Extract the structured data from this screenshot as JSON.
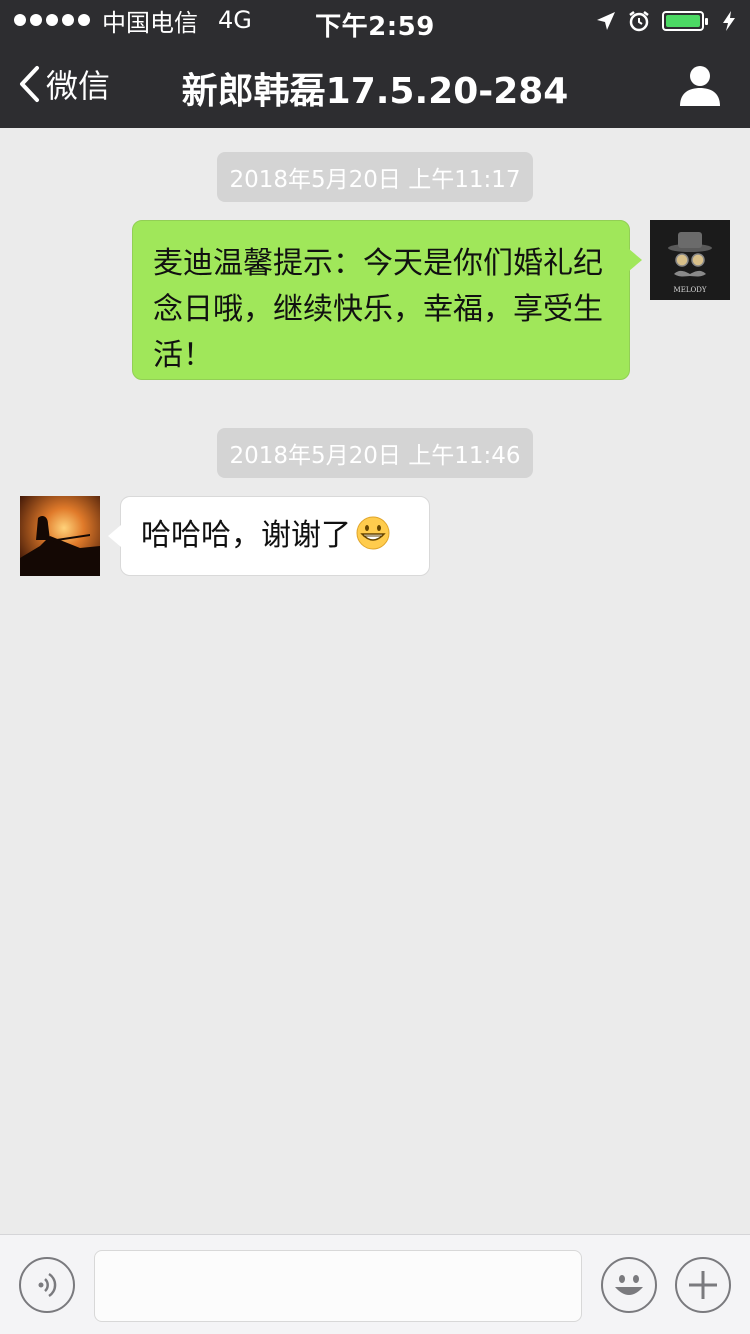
{
  "status_bar": {
    "carrier": "中国电信",
    "network": "4G",
    "time": "下午2:59"
  },
  "nav": {
    "back_label": "微信",
    "title": "新郎韩磊17.5.20-284"
  },
  "messages": [
    {
      "timestamp": "2018年5月20日 上午11:17"
    },
    {
      "text": "麦迪温馨提示：今天是你们婚礼纪念日哦，继续快乐，幸福，享受生活！",
      "sender": "me"
    },
    {
      "timestamp": "2018年5月20日 上午11:46"
    },
    {
      "text": "哈哈哈，谢谢了",
      "sender": "other",
      "emoji": "grinning-face-emoji"
    }
  ],
  "avatars": {
    "me_logo_text": "MELODY"
  },
  "colors": {
    "header_bg": "#2d2d30",
    "chat_bg": "#ebebeb",
    "my_bubble": "#a0e75a",
    "battery": "#4cd964"
  },
  "icons": [
    "location-arrow-icon",
    "alarm-icon",
    "battery-icon",
    "charging-bolt-icon",
    "back-chevron-icon",
    "profile-icon",
    "voice-icon",
    "emoji-icon",
    "plus-icon"
  ]
}
